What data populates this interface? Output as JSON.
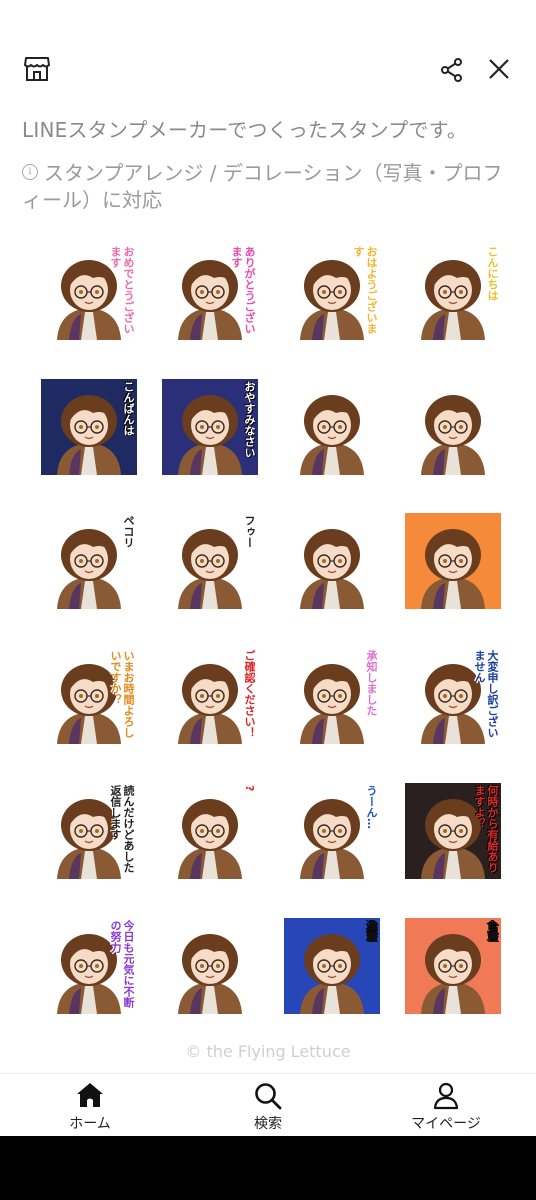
{
  "header": {
    "store_icon": "shop-icon",
    "share_icon": "share-icon",
    "close_icon": "close-icon"
  },
  "description": {
    "line1": "LINEスタンプメーカーでつくったスタンプです。",
    "info_icon": "info-icon",
    "info_text": "スタンプアレンジ / デコレーション（写真・プロフィール）に対応"
  },
  "stickers": [
    {
      "caption": "おめでとうございます",
      "bg": "#ffffff",
      "accent": "#f06aa8"
    },
    {
      "caption": "ありがとうございます",
      "bg": "#ffffff",
      "accent": "#e94bb2"
    },
    {
      "caption": "おはようございます",
      "bg": "#ffffff",
      "accent": "#f2b632"
    },
    {
      "caption": "こんにちは",
      "bg": "#ffffff",
      "accent": "#f0c02a"
    },
    {
      "caption": "こんばんは",
      "bg": "#1f2a63",
      "accent": "#ffffff"
    },
    {
      "caption": "おやすみなさい",
      "bg": "#2b2f7a",
      "accent": "#ffffff"
    },
    {
      "caption": "",
      "bg": "#ffffff",
      "accent": "#6b3d1f"
    },
    {
      "caption": "",
      "bg": "#ffffff",
      "accent": "#222222"
    },
    {
      "caption": "ペコリ",
      "bg": "#ffffff",
      "accent": "#222222"
    },
    {
      "caption": "フゥー",
      "bg": "#ffffff",
      "accent": "#222222"
    },
    {
      "caption": "",
      "bg": "#ffffff",
      "accent": "#f2c232"
    },
    {
      "caption": "",
      "bg": "#f58a3a",
      "accent": "#f2c232"
    },
    {
      "caption": "いまお時間よろしいですか？",
      "bg": "#ffffff",
      "accent": "#e48a1e"
    },
    {
      "caption": "ご確認ください！",
      "bg": "#ffffff",
      "accent": "#d9252a"
    },
    {
      "caption": "承知しました",
      "bg": "#ffffff",
      "accent": "#e070d0"
    },
    {
      "caption": "大変申し訳ございません",
      "bg": "#ffffff",
      "accent": "#1a3fa0"
    },
    {
      "caption": "読んだけどあした返信します",
      "bg": "#ffffff",
      "accent": "#222222"
    },
    {
      "caption": "?",
      "bg": "#ffffff",
      "accent": "#e8262b"
    },
    {
      "caption": "うーん…",
      "bg": "#ffffff",
      "accent": "#1a54c9"
    },
    {
      "caption": "何時から有給ありますよ？",
      "bg": "#2a2020",
      "accent": "#e02828"
    },
    {
      "caption": "今日も元気に不断の努力",
      "bg": "#ffffff",
      "accent": "#8a3ad8"
    },
    {
      "caption": "",
      "bg": "#ffffff",
      "accent": "#222222"
    },
    {
      "caption": "違憲",
      "bg": "#2746b8",
      "accent": "#111111"
    },
    {
      "caption": "合憲",
      "bg": "#f07a55",
      "accent": "#111111"
    }
  ],
  "copyright": "© the Flying Lettuce",
  "nav": [
    {
      "label": "ホーム",
      "icon": "home-icon"
    },
    {
      "label": "検索",
      "icon": "search-icon"
    },
    {
      "label": "マイページ",
      "icon": "user-icon"
    }
  ]
}
